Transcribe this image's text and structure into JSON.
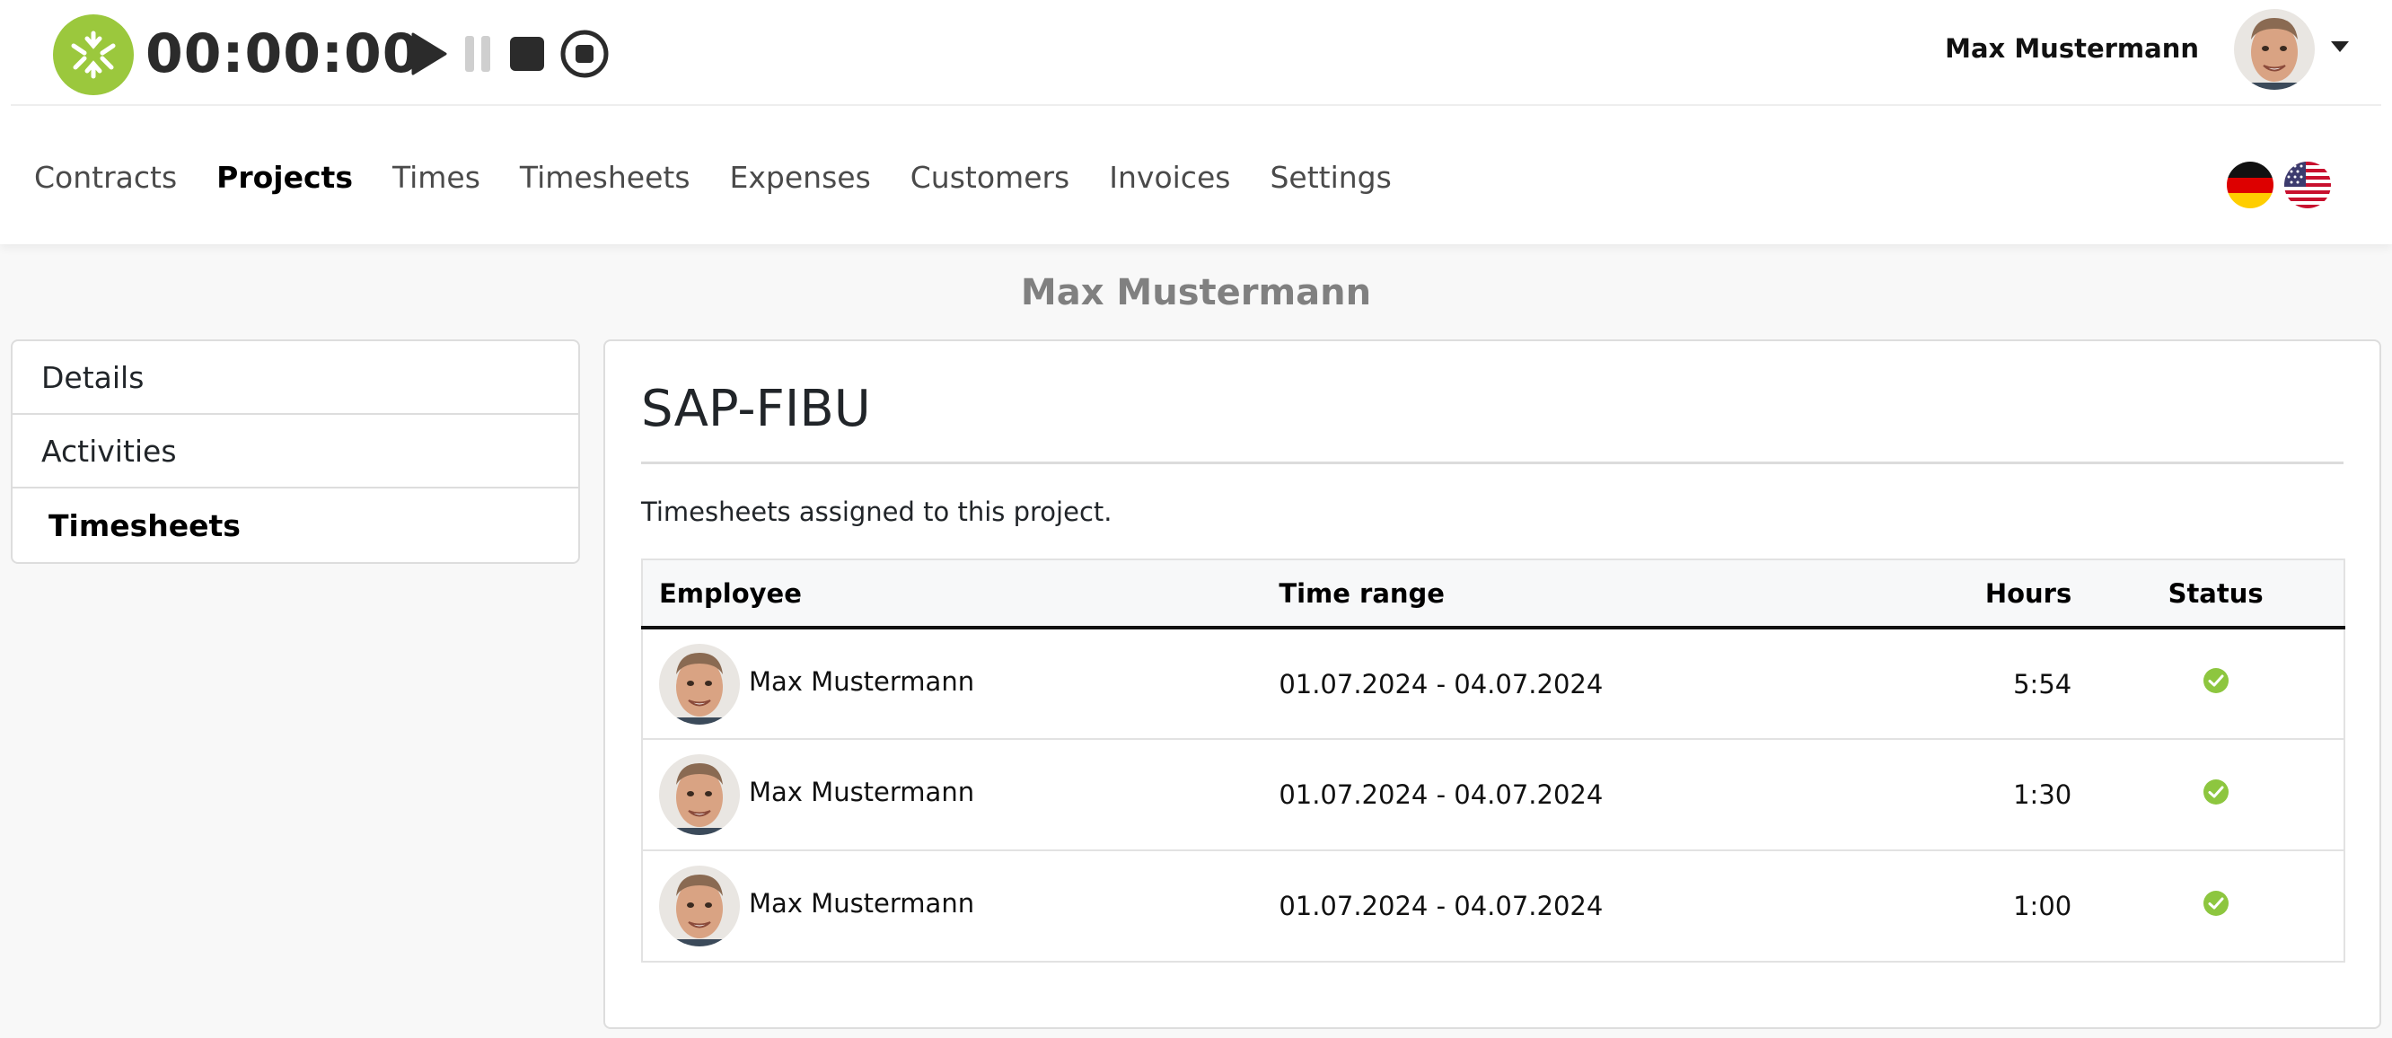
{
  "timer": {
    "display": "00:00:00",
    "controls": [
      "play-icon",
      "pause-icon",
      "stop-icon",
      "stop-circle-icon"
    ]
  },
  "user": {
    "name": "Max Mustermann",
    "avatar_icon": "user-avatar"
  },
  "nav": {
    "items": [
      {
        "label": "Contracts",
        "active": false
      },
      {
        "label": "Projects",
        "active": true
      },
      {
        "label": "Times",
        "active": false
      },
      {
        "label": "Timesheets",
        "active": false
      },
      {
        "label": "Expenses",
        "active": false
      },
      {
        "label": "Customers",
        "active": false
      },
      {
        "label": "Invoices",
        "active": false
      },
      {
        "label": "Settings",
        "active": false
      }
    ],
    "languages": [
      "flag-de-icon",
      "flag-us-icon"
    ]
  },
  "page": {
    "title": "Max Mustermann"
  },
  "sidemenu": {
    "items": [
      {
        "label": "Details",
        "active": false
      },
      {
        "label": "Activities",
        "active": false
      },
      {
        "label": "Timesheets",
        "active": true
      }
    ]
  },
  "project": {
    "name": "SAP-FIBU",
    "description": "Timesheets assigned to this project."
  },
  "table": {
    "headers": {
      "employee": "Employee",
      "time_range": "Time range",
      "hours": "Hours",
      "status": "Status"
    },
    "rows": [
      {
        "employee": "Max Mustermann",
        "time_range": "01.07.2024 - 04.07.2024",
        "hours": "5:54",
        "status": "approved"
      },
      {
        "employee": "Max Mustermann",
        "time_range": "01.07.2024 - 04.07.2024",
        "hours": "1:30",
        "status": "approved"
      },
      {
        "employee": "Max Mustermann",
        "time_range": "01.07.2024 - 04.07.2024",
        "hours": "1:00",
        "status": "approved"
      }
    ]
  },
  "colors": {
    "brand_green": "#9bc83d",
    "status_ok": "#8dc63f"
  }
}
